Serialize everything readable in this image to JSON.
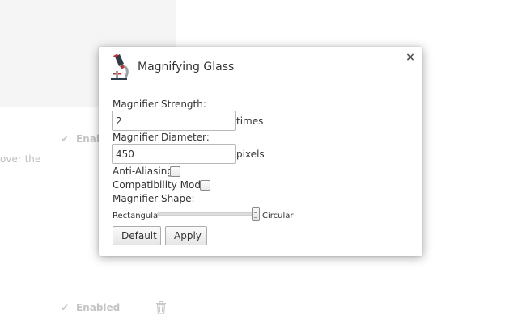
{
  "background": {
    "row1": {
      "label": "Enab",
      "checked": true
    },
    "row2": {
      "label": "Enabled",
      "checked": true
    },
    "partial_text": "over the",
    "trash_icon": "trash-icon"
  },
  "dialog": {
    "icon": "microscope-icon",
    "title": "Magnifying Glass",
    "close_symbol": "×",
    "strength": {
      "label": "Magnifier Strength:",
      "value": "2",
      "unit": "times"
    },
    "diameter": {
      "label": "Magnifier Diameter:",
      "value": "450",
      "unit": "pixels"
    },
    "anti_aliasing": {
      "label": "Anti-Aliasing",
      "checked": false
    },
    "compatibility": {
      "label": "Compatibility Mode",
      "checked": false
    },
    "shape": {
      "label": "Magnifier Shape:",
      "left_label": "Rectangular",
      "right_label": "Circular",
      "value_fraction": 1.0
    },
    "buttons": {
      "default_label": "Default",
      "apply_label": "Apply"
    }
  },
  "colors": {
    "border": "#d0d0d0",
    "icon_red": "#c9302c",
    "icon_dark": "#2f3b48"
  }
}
